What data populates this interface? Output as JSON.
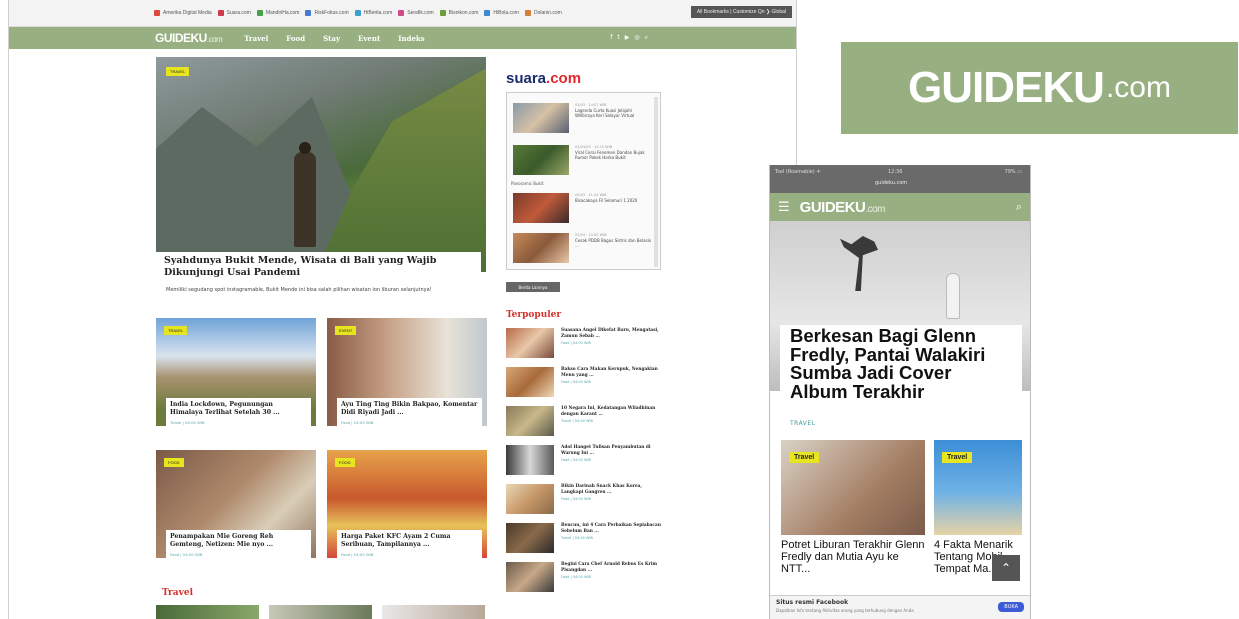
{
  "desktop": {
    "bookmarks": [
      {
        "label": "Amerika Digital Media",
        "color": "#e04a3a"
      },
      {
        "label": "Suara.com",
        "color": "#d03a4a"
      },
      {
        "label": "MandiriHa.com",
        "color": "#4aa04a"
      },
      {
        "label": "RiskFokus.com",
        "color": "#4a7ad0"
      },
      {
        "label": "HiBerita.com",
        "color": "#3aa0d0"
      },
      {
        "label": "Serafik.com",
        "color": "#d04a8a"
      },
      {
        "label": "Bisnikon.com",
        "color": "#6aa03a"
      },
      {
        "label": "HiBola.com",
        "color": "#3a8ad0"
      },
      {
        "label": "Dolanin.com",
        "color": "#d0803a"
      }
    ],
    "bookmark_right": "All Bookmarks | Customize Qn ❯ Global",
    "logo": {
      "name": "GUIDEKU",
      "com": ".com"
    },
    "nav": [
      "Travel",
      "Food",
      "Stay",
      "Event",
      "Indeks"
    ],
    "nav_icons": [
      "f",
      "t",
      "▶",
      "◎",
      "⌕"
    ],
    "hero": {
      "badge": "TRAVEL",
      "title": "Syahdunya Bukit Mende, Wisata di Bali yang Wajib Dikunjungi Usai Pandemi",
      "desc": "Memiliki segudang spot instagramable, Bukit Mende ini bisa salah pilihan wisatan ion liburan selanjutnya!"
    },
    "cards": [
      {
        "badge": "TRAVEL",
        "title": "India Lockdown, Pegunungan Himalaya Terlihat Setelah 30 ...",
        "meta": "Travel  |  04:00 WIB"
      },
      {
        "badge": "EVENT",
        "title": "Ayu Ting Ting Bikin Bakpao, Komentar Didi Riyadi Jadi ...",
        "meta": "Food  |  04:00 WIB"
      },
      {
        "badge": "FOOD",
        "title": "Penampakan Mie Goreng Reh Gemteng, Netizen: Mie nyo ...",
        "meta": "Food  |  04:00 WIB"
      },
      {
        "badge": "FOOD",
        "title": "Harga Paket KFC Ayam 2 Cuma Seribuan, Tampilannya ...",
        "meta": "Food  |  04:00 WIB"
      }
    ],
    "suara": {
      "logo_main": "suara",
      "logo_dot": ".com",
      "items": [
        {
          "date": "05/03 · 14:07 WIB",
          "title": "Lagenda Curta Kuasi Jelajahi Willbiraya Keri Selayar Virtual"
        },
        {
          "date": "04/04/03 · 12:15 WIB",
          "title": "Viral Cerai Fenomen Dandan Bujak Rumor Pakek Harka Bukit"
        },
        {
          "date": "05/03 · 11:24 WIB",
          "title": "Bisacakaya Fil Selamuri 1 2020"
        },
        {
          "date": "05/03 · 10:00 WIB",
          "title": "Cesak PDDB Bagus Sistris dan Belasin ..."
        }
      ],
      "caption": "Panoramic Bukit"
    },
    "more_button": "Berita Lainnya",
    "popular_heading": "Terpopuler",
    "popular": [
      {
        "title": "Suasana Angel Dikefat Baru, Mengatasi, Zamun Sebab ...",
        "meta": "Food  |  04:00 WIB"
      },
      {
        "title": "Bakso Cara Makan Kerupuk, Nengakian Menu yang ...",
        "meta": "Food  |  04:00 WIB"
      },
      {
        "title": "10 Negara Ini, Kedatangan Wiladhinan dengan Karant ...",
        "meta": "Travel  |  04:00 WIB"
      },
      {
        "title": "Adol Hanget Tulisan Penyambutan di Warung Ini ...",
        "meta": "Food  |  04:00 WIB"
      },
      {
        "title": "Bikin Darinah Snack Khas Korea, Langkapi Gangren ...",
        "meta": "Food  |  04:00 WIB"
      },
      {
        "title": "Bencuu, ini 4 Cara Perbaikan Sepiabacan Sebelum Ban ...",
        "meta": "Travel  |  04:00 WIB"
      },
      {
        "title": "Begini Cara Chef Arnold Rebus Es Krim Pisangdan ...",
        "meta": "Food  |  04:00 WIB"
      }
    ],
    "section_heading": "Travel"
  },
  "brand": {
    "name": "GUIDEKU",
    "com": ".com"
  },
  "mobile": {
    "status_left": "Tsel (Roamable) ✈",
    "status_time": "12:36",
    "status_right": "79% ▭",
    "url": "guideku.com",
    "logo": {
      "name": "GUIDEKU",
      "com": ".com"
    },
    "hero_title": "Berkesan Bagi Glenn Fredly, Pantai Walakiri Sumba Jadi Cover Album Terakhir",
    "hero_category": "TRAVEL",
    "card1": {
      "badge": "Travel",
      "title": "Potret Liburan Terakhir Glenn Fredly dan Mutia Ayu ke NTT..."
    },
    "card2": {
      "badge": "Travel",
      "title": "4 Fakta Menarik Tentang Mobil Tempat Ma..."
    },
    "back_icon": "⌃",
    "fb": {
      "title": "Situs resmi Facebook",
      "sub": "Dapatkan Info tentang Aktivitas orang yang terhubung dengan Anda",
      "button": "BUKA"
    }
  },
  "colors": {
    "brand_green": "#98b081",
    "badge_yellow": "#e7e51f",
    "heading_red": "#d0342c",
    "meta_teal": "#5aa6a6"
  }
}
